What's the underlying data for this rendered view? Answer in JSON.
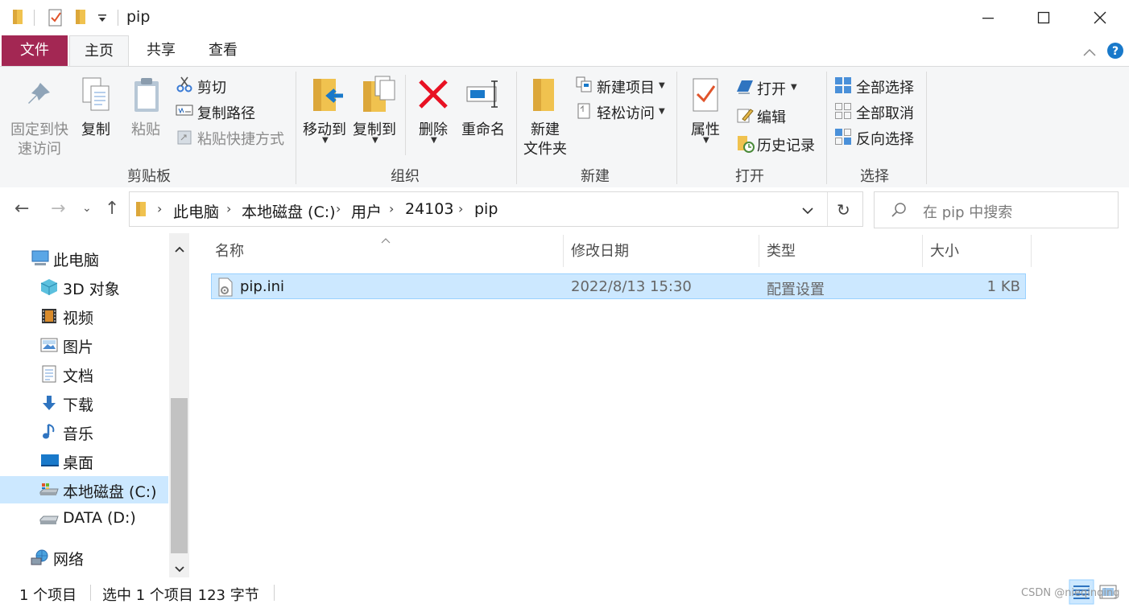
{
  "window": {
    "title": "pip",
    "controls": [
      "minimize-icon",
      "maximize-icon",
      "close-icon"
    ]
  },
  "ribbon_tabs": [
    {
      "label": "文件"
    },
    {
      "label": "主页"
    },
    {
      "label": "共享"
    },
    {
      "label": "查看"
    }
  ],
  "ribbon": {
    "clipboard": {
      "pin_label_line1": "固定到快",
      "pin_label_line2": "速访问",
      "copy": "复制",
      "paste": "粘贴",
      "cut": "剪切",
      "copy_path": "复制路径",
      "paste_shortcut": "粘贴快捷方式",
      "group": "剪贴板"
    },
    "organize": {
      "move_to": "移动到",
      "copy_to": "复制到",
      "delete": "删除",
      "rename": "重命名",
      "group": "组织"
    },
    "new": {
      "new_folder_line1": "新建",
      "new_folder_line2": "文件夹",
      "new_item": "新建项目",
      "easy_access": "轻松访问",
      "group": "新建"
    },
    "open": {
      "properties": "属性",
      "open": "打开",
      "edit": "编辑",
      "history": "历史记录",
      "group": "打开"
    },
    "select": {
      "select_all": "全部选择",
      "select_none": "全部取消",
      "invert": "反向选择",
      "group": "选择"
    }
  },
  "address": {
    "crumbs": [
      "此电脑",
      "本地磁盘 (C:)",
      "用户",
      "24103",
      "pip"
    ],
    "search_placeholder": "在 pip 中搜索"
  },
  "nav": {
    "items": [
      {
        "label": "此电脑",
        "icon": "computer-icon"
      },
      {
        "label": "3D 对象",
        "icon": "cube-icon"
      },
      {
        "label": "视频",
        "icon": "film-icon"
      },
      {
        "label": "图片",
        "icon": "picture-icon"
      },
      {
        "label": "文档",
        "icon": "document-icon"
      },
      {
        "label": "下载",
        "icon": "download-arrow-icon"
      },
      {
        "label": "音乐",
        "icon": "music-note-icon"
      },
      {
        "label": "桌面",
        "icon": "desktop-icon"
      },
      {
        "label": "本地磁盘 (C:)",
        "icon": "drive-c-icon",
        "selected": true
      },
      {
        "label": "DATA (D:)",
        "icon": "drive-d-icon"
      },
      {
        "label": "网络",
        "icon": "network-icon"
      }
    ]
  },
  "file_list": {
    "columns": [
      "名称",
      "修改日期",
      "类型",
      "大小"
    ],
    "rows": [
      {
        "name": "pip.ini",
        "modified": "2022/8/13 15:30",
        "type": "配置设置",
        "size": "1 KB",
        "selected": true
      }
    ]
  },
  "status": {
    "count": "1 个项目",
    "selection": "选中 1 个项目  123 字节"
  },
  "watermark": "CSDN @nieqinqing",
  "colors": {
    "file_tab": "#a32753",
    "selection": "#cce8ff",
    "selection_border": "#99d1ff",
    "ribbon_bg": "#f5f6f7",
    "folder": "#f0c24f",
    "accent_blue": "#1979ca",
    "delete_red": "#e81123"
  }
}
